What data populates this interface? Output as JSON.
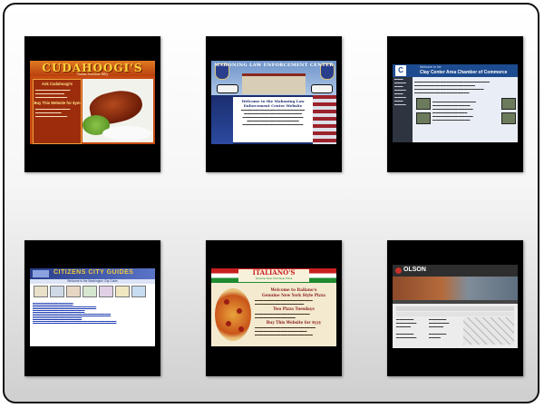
{
  "gallery": {
    "thumbnails": [
      {
        "name": "Cudahoogi's",
        "title": "CUDAHOOGI'S",
        "subtitle": "Classic American BBQ",
        "heading_1": "Ask Cudahoogi's",
        "heading_2": "Buy This Website for $ym"
      },
      {
        "name": "Mahoning Law Enforcement Center",
        "header": "MAHONING LAW ENFORCEMENT CENTER",
        "welcome": "Welcome to the Mahoning Law Enforcement Center Website"
      },
      {
        "name": "Clay Center Area Chamber of Commerce",
        "small_title": "Welcome to the",
        "title": "Clay Center Area Chamber of Commerce",
        "logo_letter": "C"
      },
      {
        "name": "Citizens City Guides",
        "title": "CITIZENS CITY GUIDES",
        "welcome": "Welcome to the Washington City Guide"
      },
      {
        "name": "Italiano's",
        "title": "ITALIANO'S",
        "subtitle": "Genuine New York Style Pizza",
        "welcome_1": "Welcome to Italiano's",
        "welcome_2": "Genuine New York Style Pizza",
        "promo": "Two Pizza Tuesdays",
        "buy": "Buy This Website for $yyy"
      },
      {
        "name": "Olson",
        "title": "OLSON"
      }
    ]
  },
  "colors": {
    "frame_border": "#111111",
    "tile_background": "#000000"
  }
}
